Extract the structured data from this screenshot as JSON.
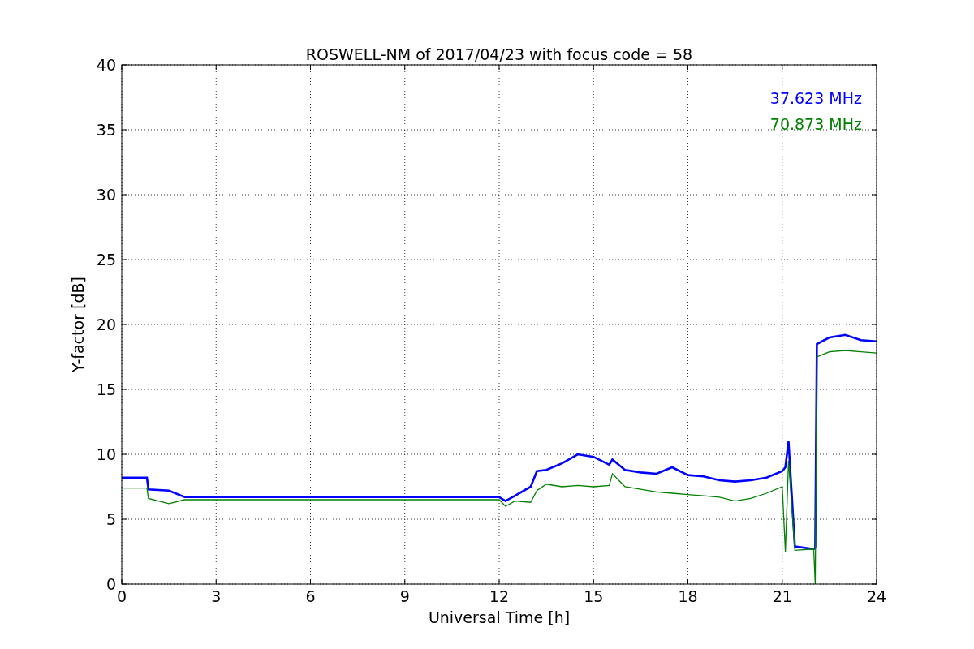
{
  "chart_data": {
    "type": "line",
    "title": "ROSWELL-NM of 2017/04/23 with focus code = 58",
    "xlabel": "Universal Time [h]",
    "ylabel": "Y-factor [dB]",
    "x": [
      0,
      0.8,
      0.85,
      1.5,
      2,
      12,
      12.2,
      12.5,
      13,
      13.2,
      13.5,
      14,
      14.5,
      15,
      15.5,
      15.6,
      16,
      16.5,
      17,
      17.5,
      18,
      18.5,
      19,
      19.5,
      20,
      20.5,
      21,
      21.1,
      21.2,
      21.4,
      22,
      22.05,
      22.1,
      22.5,
      23,
      23.5,
      24
    ],
    "series": [
      {
        "name": "37.623 MHz",
        "color": "#0000ff",
        "values": [
          8.2,
          8.2,
          7.3,
          7.2,
          6.7,
          6.7,
          6.4,
          6.8,
          7.5,
          8.7,
          8.8,
          9.3,
          10,
          9.8,
          9.2,
          9.6,
          8.8,
          8.6,
          8.5,
          9,
          8.4,
          8.3,
          8,
          7.9,
          8,
          8.2,
          8.7,
          9,
          11,
          2.9,
          2.7,
          2.8,
          18.5,
          19,
          19.2,
          18.8,
          18.7
        ]
      },
      {
        "name": "70.873 MHz",
        "color": "#008000",
        "values": [
          7.4,
          7.4,
          6.6,
          6.2,
          6.5,
          6.5,
          6.0,
          6.4,
          6.3,
          7.2,
          7.7,
          7.5,
          7.6,
          7.5,
          7.6,
          8.5,
          7.5,
          7.3,
          7.1,
          7.0,
          6.9,
          6.8,
          6.7,
          6.4,
          6.6,
          7,
          7.5,
          2.5,
          9.5,
          2.6,
          2.7,
          0,
          17.5,
          17.9,
          18,
          17.9,
          17.8
        ]
      }
    ],
    "grid": true,
    "xlim": [
      0,
      24
    ],
    "ylim": [
      0,
      40
    ],
    "xticks": [
      0,
      3,
      6,
      9,
      12,
      15,
      18,
      21,
      24
    ],
    "yticks": [
      0,
      5,
      10,
      15,
      20,
      25,
      30,
      35,
      40
    ]
  }
}
